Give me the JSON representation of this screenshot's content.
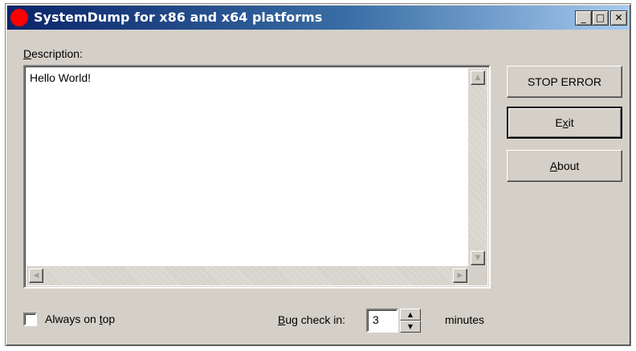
{
  "window": {
    "title": "SystemDump for x86 and x64 platforms",
    "controls": {
      "minimize": "_",
      "maximize": "□",
      "close": "✕"
    }
  },
  "description": {
    "label_u": "D",
    "label_rest": "escription:",
    "text": "Hello World!"
  },
  "buttons": {
    "stop_error": "STOP ERROR",
    "exit_pre": "E",
    "exit_u": "x",
    "exit_post": "it",
    "about_u": "A",
    "about_post": "bout"
  },
  "options": {
    "always_on_top_pre": "Always on ",
    "always_on_top_u": "t",
    "always_on_top_post": "op",
    "always_on_top_checked": false
  },
  "bug_check": {
    "label_u": "B",
    "label_rest": "ug check in:",
    "value": "3",
    "unit": "minutes"
  },
  "icons": {
    "app": "red-circle-icon",
    "scroll_up": "▲",
    "scroll_down": "▼",
    "scroll_left": "◀",
    "scroll_right": "▶",
    "spin_up": "▲",
    "spin_down": "▼"
  }
}
